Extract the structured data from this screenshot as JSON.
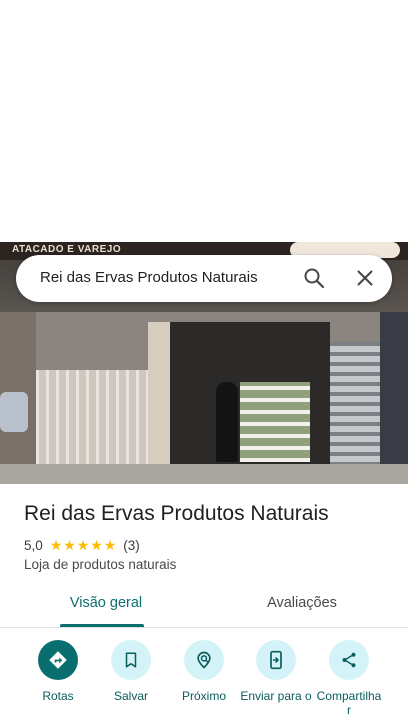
{
  "search": {
    "query": "Rei das Ervas Produtos Naturais"
  },
  "photo": {
    "banner_text": "ATACADO E VAREJO"
  },
  "place": {
    "name": "Rei das Ervas Produtos Naturais",
    "rating": "5,0",
    "stars": [
      "★",
      "★",
      "★",
      "★",
      "★"
    ],
    "review_count": "(3)",
    "category": "Loja de produtos naturais"
  },
  "tabs": [
    {
      "label": "Visão geral",
      "selected": true
    },
    {
      "label": "Avaliações",
      "selected": false
    }
  ],
  "actions": [
    {
      "label": "Rotas",
      "icon": "directions-icon"
    },
    {
      "label": "Salvar",
      "icon": "bookmark-icon"
    },
    {
      "label": "Próximo",
      "icon": "nearby-icon"
    },
    {
      "label": "Enviar para o",
      "icon": "send-to-phone-icon"
    },
    {
      "label": "Compartilha r",
      "icon": "share-icon"
    }
  ],
  "colors": {
    "accent": "#0b6e6e",
    "action_bg": "#d3f3f8",
    "star": "#fbbc04"
  }
}
